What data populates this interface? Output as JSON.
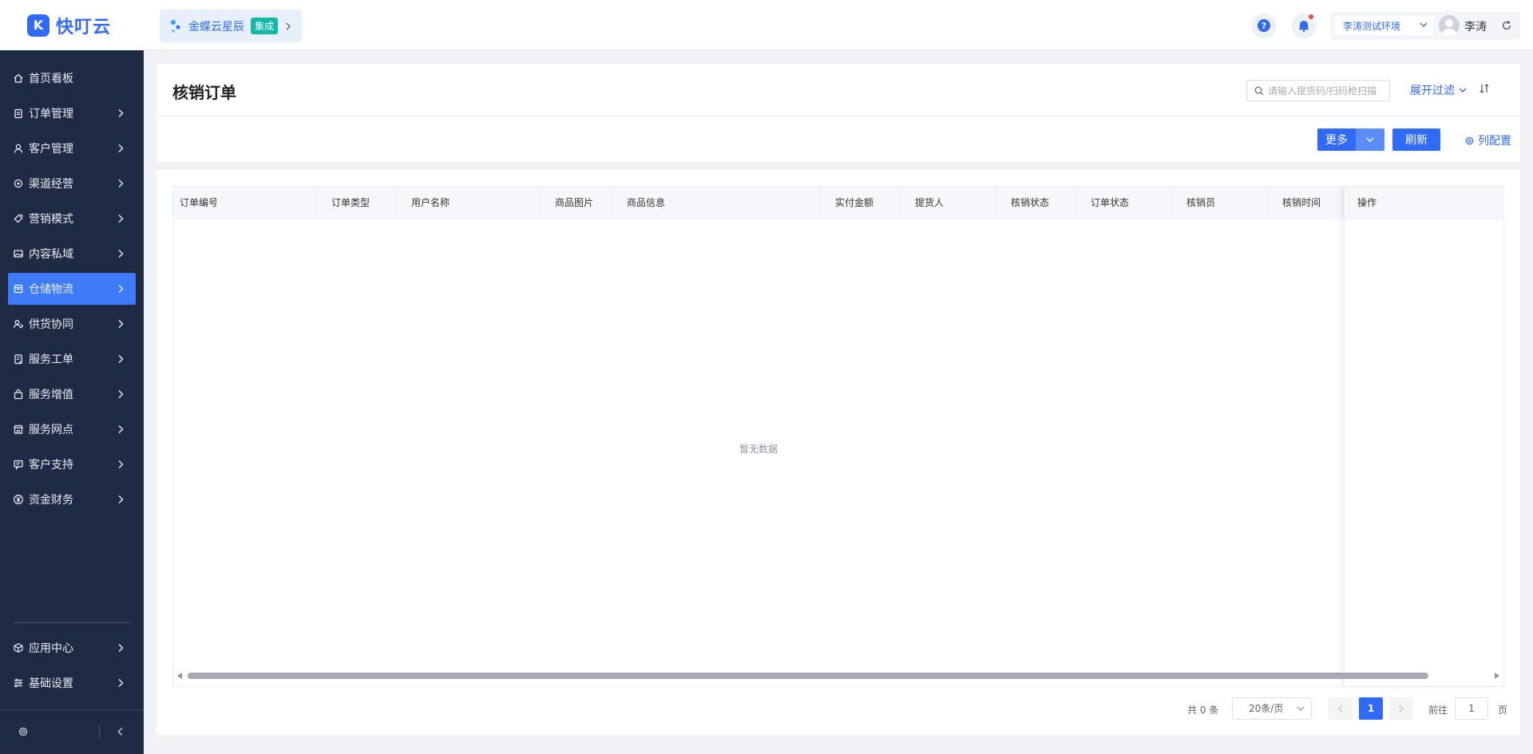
{
  "app": {
    "logo_text": "快叮云",
    "logo_mark": "K"
  },
  "integration": {
    "name": "金蝶云星辰",
    "badge": "集成"
  },
  "header": {
    "environment": "李涛测试环境",
    "user_name": "李涛"
  },
  "sidebar": {
    "items": [
      {
        "label": "首页看板",
        "icon": "home-icon",
        "has_arrow": false,
        "active": false
      },
      {
        "label": "订单管理",
        "icon": "clipboard-icon",
        "has_arrow": true,
        "active": false
      },
      {
        "label": "客户管理",
        "icon": "user-icon",
        "has_arrow": true,
        "active": false
      },
      {
        "label": "渠道经营",
        "icon": "channel-icon",
        "has_arrow": true,
        "active": false
      },
      {
        "label": "营销模式",
        "icon": "tag-icon",
        "has_arrow": true,
        "active": false
      },
      {
        "label": "内容私域",
        "icon": "image-icon",
        "has_arrow": true,
        "active": false
      },
      {
        "label": "仓储物流",
        "icon": "box-icon",
        "has_arrow": true,
        "active": true
      },
      {
        "label": "供货协同",
        "icon": "supply-icon",
        "has_arrow": true,
        "active": false
      },
      {
        "label": "服务工单",
        "icon": "ticket-icon",
        "has_arrow": true,
        "active": false
      },
      {
        "label": "服务增值",
        "icon": "bag-icon",
        "has_arrow": true,
        "active": false
      },
      {
        "label": "服务网点",
        "icon": "store-icon",
        "has_arrow": true,
        "active": false
      },
      {
        "label": "客户支持",
        "icon": "support-icon",
        "has_arrow": true,
        "active": false
      },
      {
        "label": "资金财务",
        "icon": "yen-icon",
        "has_arrow": true,
        "active": false
      }
    ],
    "bottom_items": [
      {
        "label": "应用中心",
        "icon": "cube-icon"
      },
      {
        "label": "基础设置",
        "icon": "settings-sliders-icon"
      }
    ]
  },
  "page": {
    "title": "核销订单",
    "search_placeholder": "请输入提货码/扫码枪扫描",
    "filter_label": "展开过滤",
    "more_label": "更多",
    "refresh_label": "刷新",
    "column_config_label": "列配置"
  },
  "table": {
    "columns": [
      "订单编号",
      "订单类型",
      "用户名称",
      "商品图片",
      "商品信息",
      "实付金额",
      "提货人",
      "核销状态",
      "订单状态",
      "核销员",
      "核销时间"
    ],
    "action_column": "操作",
    "empty_text": "暂无数据"
  },
  "pagination": {
    "total_text": "共 0 条",
    "page_size": "20条/页",
    "current_page": "1",
    "goto_label": "前往",
    "goto_value": "1",
    "page_suffix": "页"
  },
  "colors": {
    "accent": "#2f6bf7",
    "sidebar_bg": "#1f2a44",
    "active_bg": "#3d7bf8",
    "badge": "#14b8a6"
  }
}
